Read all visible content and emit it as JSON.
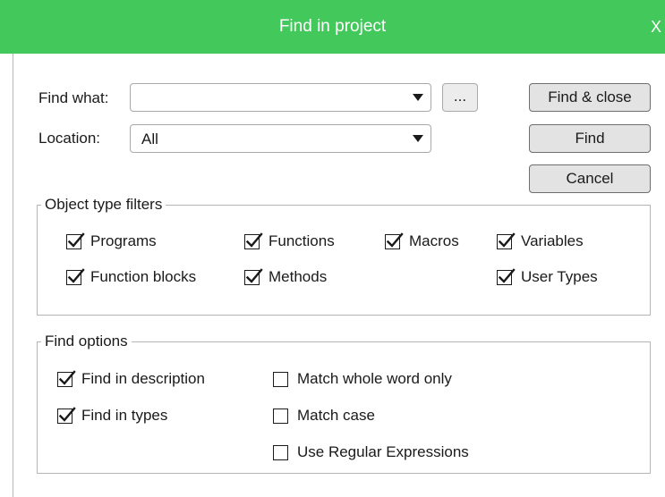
{
  "dialog": {
    "title": "Find in project",
    "close_label": "X"
  },
  "find_what": {
    "label": "Find what:",
    "value": "",
    "browse_label": "..."
  },
  "location": {
    "label": "Location:",
    "value": "All"
  },
  "buttons": {
    "find_close": "Find & close",
    "find": "Find",
    "cancel": "Cancel"
  },
  "object_filters": {
    "legend": "Object type filters",
    "items": [
      {
        "label": "Programs",
        "checked": true
      },
      {
        "label": "Functions",
        "checked": true
      },
      {
        "label": "Macros",
        "checked": true
      },
      {
        "label": "Variables",
        "checked": true
      },
      {
        "label": "Function blocks",
        "checked": true
      },
      {
        "label": "Methods",
        "checked": true
      },
      {
        "label": "User Types",
        "checked": true
      }
    ]
  },
  "find_options": {
    "legend": "Find options",
    "items": [
      {
        "label": "Find in description",
        "checked": true
      },
      {
        "label": "Find in types",
        "checked": true
      },
      {
        "label": "Match whole word only",
        "checked": false
      },
      {
        "label": "Match case",
        "checked": false
      },
      {
        "label": "Use Regular Expressions",
        "checked": false
      }
    ]
  }
}
